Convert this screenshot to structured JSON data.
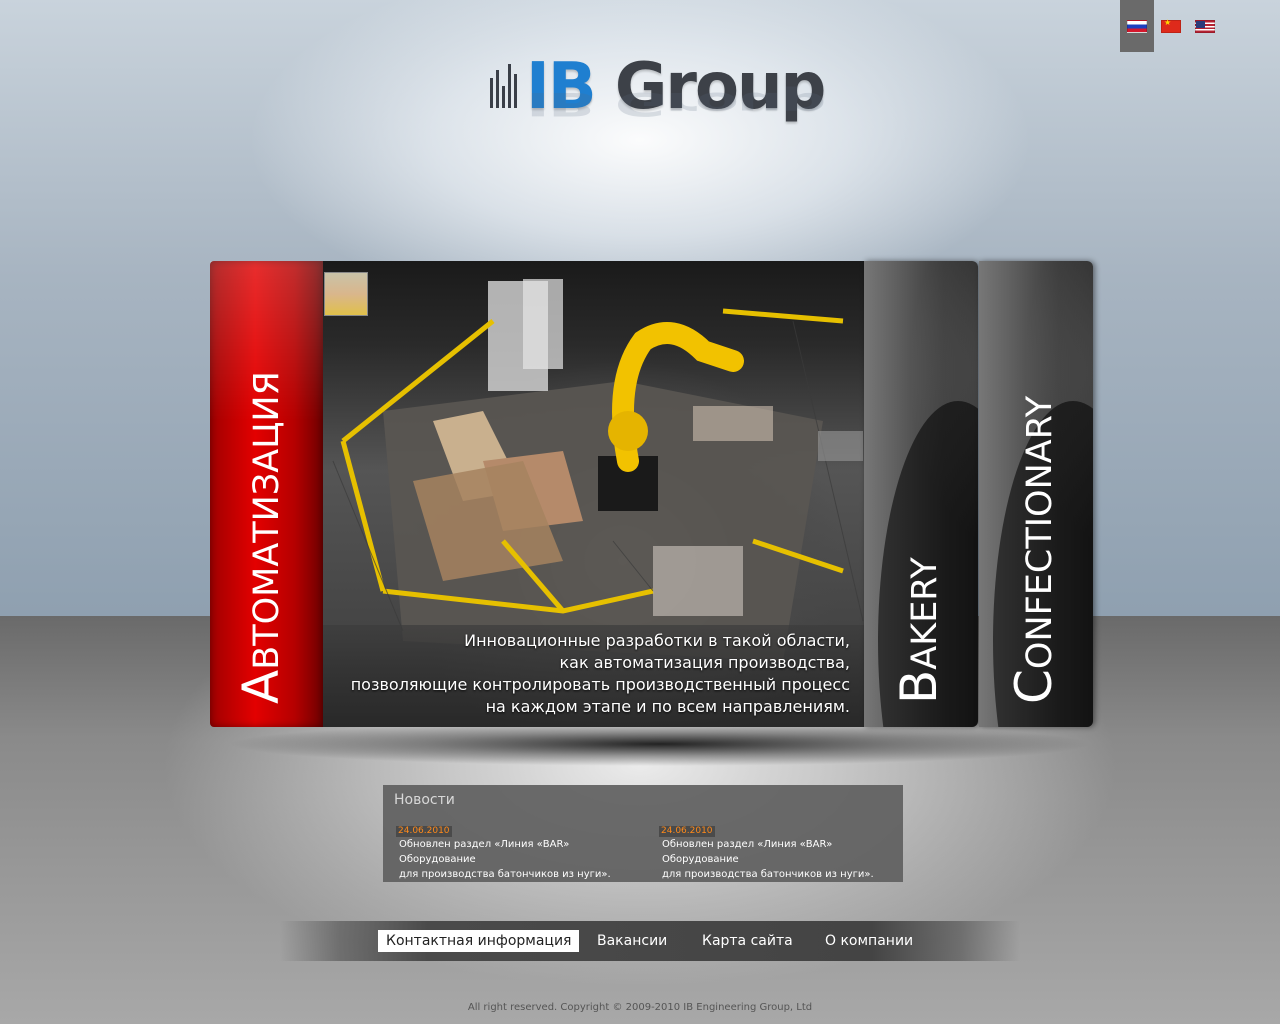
{
  "languages": [
    {
      "code": "ru",
      "icon": "russia-flag-icon",
      "active": true
    },
    {
      "code": "cn",
      "icon": "china-flag-icon",
      "active": false
    },
    {
      "code": "us",
      "icon": "usa-flag-icon",
      "active": false
    }
  ],
  "logo": {
    "prefix": "IB",
    "suffix": " Group"
  },
  "slider": {
    "active_tab": "Автоматизация",
    "tabs": [
      "Bakery",
      "Confectionary"
    ],
    "caption": [
      "Инновационные разработки в такой области,",
      "как автоматизация производства,",
      "позволяющие контролировать производственный процесс",
      "на каждом этапе и по всем направлениям."
    ]
  },
  "news": {
    "title": "Новости",
    "items": [
      {
        "date": "24.06.2010",
        "text_line1": "Обновлен раздел «Линия «BAR» Оборудование",
        "text_line2": "для производства батончиков из нуги»."
      },
      {
        "date": "24.06.2010",
        "text_line1": "Обновлен раздел «Линия «BAR» Оборудование",
        "text_line2": "для производства батончиков из нуги»."
      }
    ]
  },
  "nav": {
    "contacts": "Контактная информация",
    "vacancies": "Вакансии",
    "sitemap": "Карта сайта",
    "about": "О компании"
  },
  "footer": {
    "copyright": "All right reserved. Copyright © 2009-2010 IB Engineering Group, Ltd"
  },
  "colors": {
    "accent_red": "#e30000",
    "brand_blue": "#1f7fd0",
    "news_date": "#ff8a1a"
  }
}
